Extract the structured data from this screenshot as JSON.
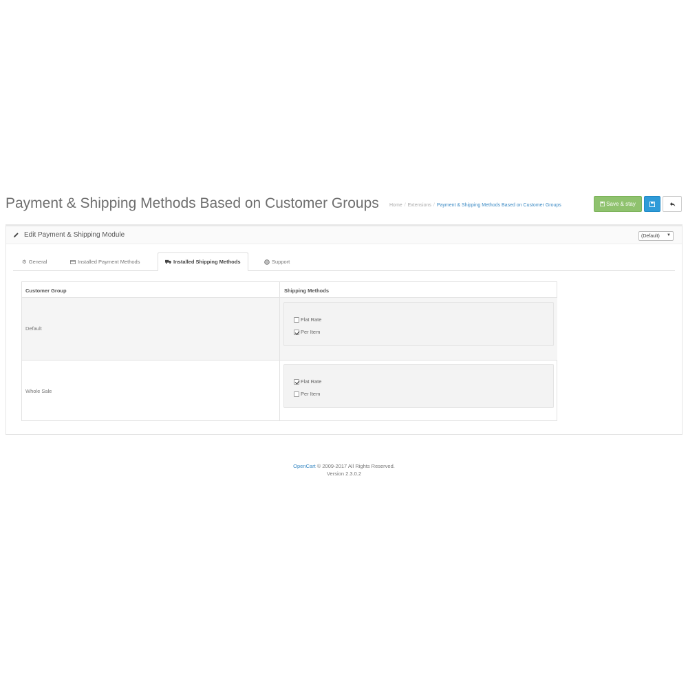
{
  "page": {
    "title": "Payment & Shipping Methods Based on Customer Groups"
  },
  "breadcrumb": [
    "Home",
    "Extensions",
    "Payment & Shipping Methods Based on Customer Groups"
  ],
  "toolbar": {
    "save_stay_label": "Save & stay",
    "save_icon": "save-icon",
    "back_icon": "reply-icon"
  },
  "panel": {
    "title": "Edit Payment & Shipping Module",
    "store_select_value": "(Default)"
  },
  "tabs": [
    {
      "label": "General",
      "icon": "cogs-icon"
    },
    {
      "label": "Installed Payment Methods",
      "icon": "credit-card-icon"
    },
    {
      "label": "Installed Shipping Methods",
      "icon": "truck-icon",
      "active": true
    },
    {
      "label": "Support",
      "icon": "life-ring-icon"
    }
  ],
  "shipping_table": {
    "headers": [
      "Customer Group",
      "Shipping Methods"
    ],
    "rows": [
      {
        "group": "Default",
        "methods": [
          {
            "label": "Flat Rate",
            "checked": false
          },
          {
            "label": "Per Item",
            "checked": true
          }
        ]
      },
      {
        "group": "Whole Sale",
        "methods": [
          {
            "label": "Flat Rate",
            "checked": true
          },
          {
            "label": "Per Item",
            "checked": false
          }
        ]
      }
    ]
  },
  "footer": {
    "brand": "OpenCart",
    "copyright": " © 2009-2017 All Rights Reserved.",
    "version": "Version 2.3.0.2"
  },
  "colors": {
    "success": "#8fc26e",
    "primary": "#2f9bd8",
    "link": "#3b8ac4"
  }
}
